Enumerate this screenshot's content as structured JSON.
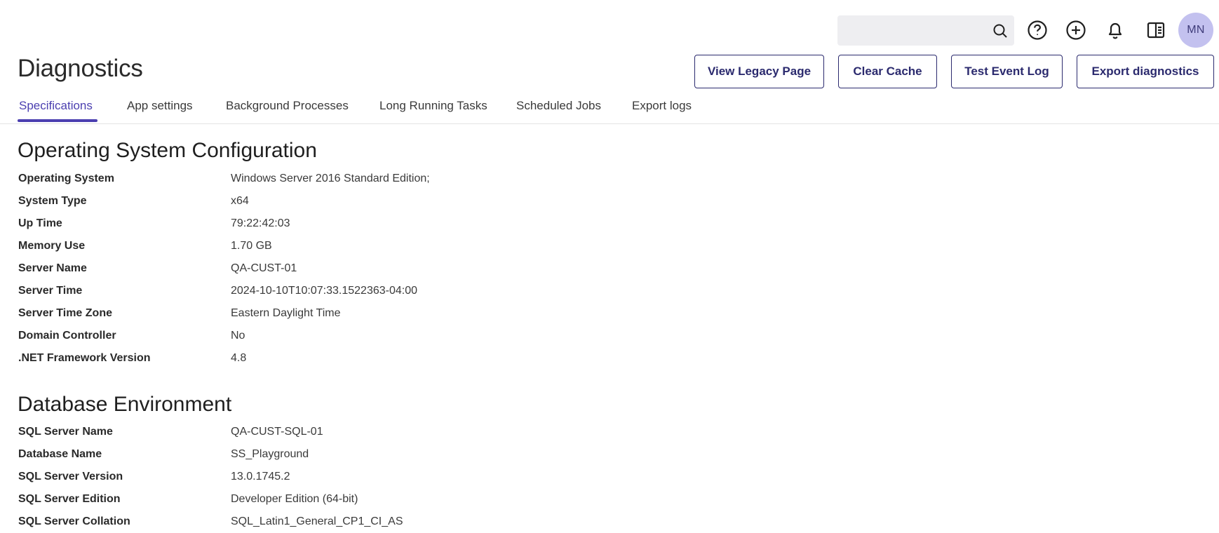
{
  "header": {
    "title": "Diagnostics",
    "search_placeholder": "",
    "user_initials": "MN",
    "icons": [
      "search-icon",
      "help-icon",
      "add-circle-icon",
      "bell-icon",
      "panel-icon"
    ]
  },
  "actions": {
    "view_legacy": "View Legacy Page",
    "clear_cache": "Clear Cache",
    "test_event_log": "Test Event Log",
    "export_diagnostics": "Export diagnostics"
  },
  "tabs": [
    {
      "label": "Specifications",
      "active": true
    },
    {
      "label": "App settings",
      "active": false
    },
    {
      "label": "Background Processes",
      "active": false
    },
    {
      "label": "Long Running Tasks",
      "active": false
    },
    {
      "label": "Scheduled Jobs",
      "active": false
    },
    {
      "label": "Export logs",
      "active": false
    }
  ],
  "os": {
    "title": "Operating System Configuration",
    "rows": [
      {
        "label": "Operating System",
        "value": "Windows Server 2016 Standard Edition;"
      },
      {
        "label": "System Type",
        "value": "x64"
      },
      {
        "label": "Up Time",
        "value": "79:22:42:03"
      },
      {
        "label": "Memory Use",
        "value": "1.70 GB"
      },
      {
        "label": "Server Name",
        "value": "QA-CUST-01"
      },
      {
        "label": "Server Time",
        "value": "2024-10-10T10:07:33.1522363-04:00"
      },
      {
        "label": "Server Time Zone",
        "value": "Eastern Daylight Time"
      },
      {
        "label": "Domain Controller",
        "value": "No"
      },
      {
        "label": ".NET Framework Version",
        "value": "4.8"
      }
    ]
  },
  "db": {
    "title": "Database Environment",
    "rows": [
      {
        "label": "SQL Server Name",
        "value": "QA-CUST-SQL-01"
      },
      {
        "label": "Database Name",
        "value": "SS_Playground"
      },
      {
        "label": "SQL Server Version",
        "value": "13.0.1745.2"
      },
      {
        "label": "SQL Server Edition",
        "value": "Developer Edition (64-bit)"
      },
      {
        "label": "SQL Server Collation",
        "value": "SQL_Latin1_General_CP1_CI_AS"
      }
    ]
  },
  "colors": {
    "accent": "#4b3fb0",
    "button_border": "#2b2a6e",
    "avatar_bg": "#c3c1ef",
    "search_bg": "#eeeef1"
  }
}
